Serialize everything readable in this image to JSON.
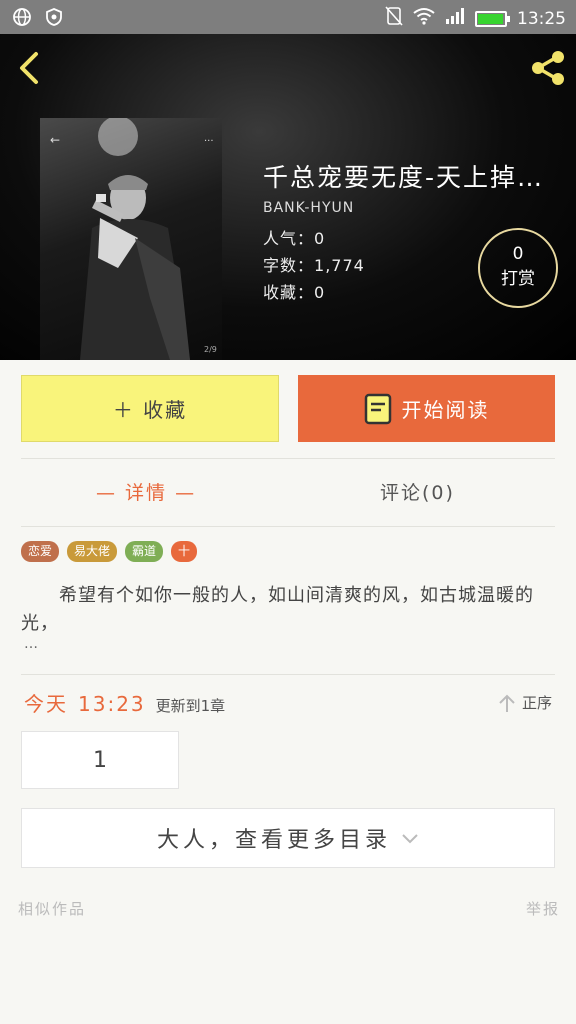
{
  "status_bar": {
    "time": "13:25"
  },
  "book": {
    "title": "千总宠要无度-天上掉…",
    "author": "BANK-HYUN",
    "stats": [
      {
        "label": "人气：",
        "value": "0"
      },
      {
        "label": "字数：",
        "value": "1,774"
      },
      {
        "label": "收藏：",
        "value": "0"
      }
    ],
    "tip": {
      "count": "0",
      "label": "打赏"
    }
  },
  "actions": {
    "favorite_label": "＋ 收藏",
    "read_label": "开始阅读"
  },
  "tabs": {
    "detail": "— 详情 —",
    "comments": "评论(0)"
  },
  "tags": [
    {
      "label": "恋爱",
      "color": "#c0704c"
    },
    {
      "label": "易大佬",
      "color": "#c99a3a"
    },
    {
      "label": "霸道",
      "color": "#7fae55"
    },
    {
      "label": "十",
      "color": "#e8693c"
    }
  ],
  "description": "希望有个如你一般的人，如山间清爽的风，如古城温暖的光，",
  "description_more": "…",
  "update": {
    "day": "今天",
    "time": "13:23",
    "text": "更新到1章"
  },
  "sort_label": "正序",
  "chapters": [
    "1"
  ],
  "more_catalog": "大人，查看更多目录",
  "footer": {
    "similar": "相似作品",
    "report": "举报"
  },
  "colors": {
    "accent": "#e8693c",
    "favorite": "#f9f47b"
  }
}
